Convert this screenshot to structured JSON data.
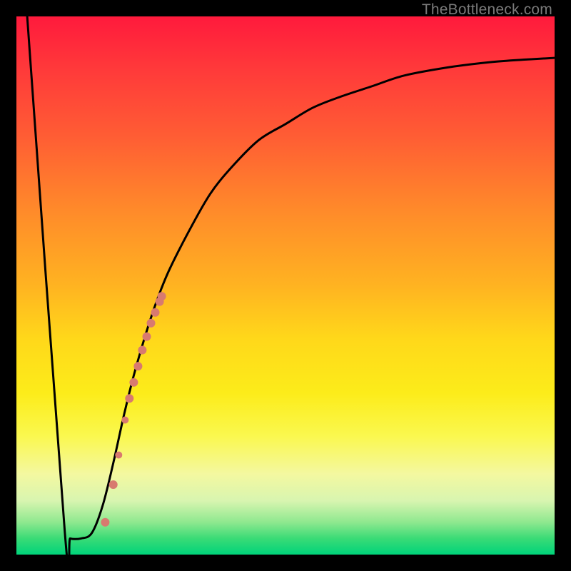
{
  "watermark": "TheBottleneck.com",
  "colors": {
    "curve_stroke": "#000000",
    "dot_fill": "#d87a6f",
    "frame_bg": "#000000"
  },
  "chart_data": {
    "type": "line",
    "title": "",
    "xlabel": "",
    "ylabel": "",
    "xlim": [
      0,
      100
    ],
    "ylim": [
      0,
      100
    ],
    "series": [
      {
        "name": "curve",
        "x": [
          2,
          9,
          10,
          12,
          14,
          16,
          18,
          20,
          22,
          25,
          28,
          32,
          36,
          40,
          45,
          50,
          55,
          60,
          66,
          72,
          80,
          88,
          95,
          100
        ],
        "y": [
          100,
          4,
          3,
          3,
          4,
          9,
          17,
          26,
          34,
          44,
          52,
          60,
          67,
          72,
          77,
          80,
          83,
          85,
          87,
          89,
          90.5,
          91.5,
          92,
          92.3
        ]
      }
    ],
    "dots": {
      "name": "highlight-dots",
      "x_range": [
        16.5,
        27
      ],
      "y_range": [
        6,
        48
      ],
      "points": [
        {
          "x": 16.5,
          "y": 6,
          "r": 6
        },
        {
          "x": 18.0,
          "y": 13,
          "r": 6
        },
        {
          "x": 19.0,
          "y": 18.5,
          "r": 5
        },
        {
          "x": 20.2,
          "y": 25,
          "r": 5
        },
        {
          "x": 21.0,
          "y": 29,
          "r": 6
        },
        {
          "x": 21.8,
          "y": 32,
          "r": 6
        },
        {
          "x": 22.6,
          "y": 35,
          "r": 6
        },
        {
          "x": 23.4,
          "y": 38,
          "r": 6
        },
        {
          "x": 24.2,
          "y": 40.5,
          "r": 6
        },
        {
          "x": 25.0,
          "y": 43,
          "r": 6
        },
        {
          "x": 25.8,
          "y": 45,
          "r": 6
        },
        {
          "x": 26.6,
          "y": 47,
          "r": 6
        },
        {
          "x": 27.0,
          "y": 48,
          "r": 6
        }
      ]
    }
  }
}
